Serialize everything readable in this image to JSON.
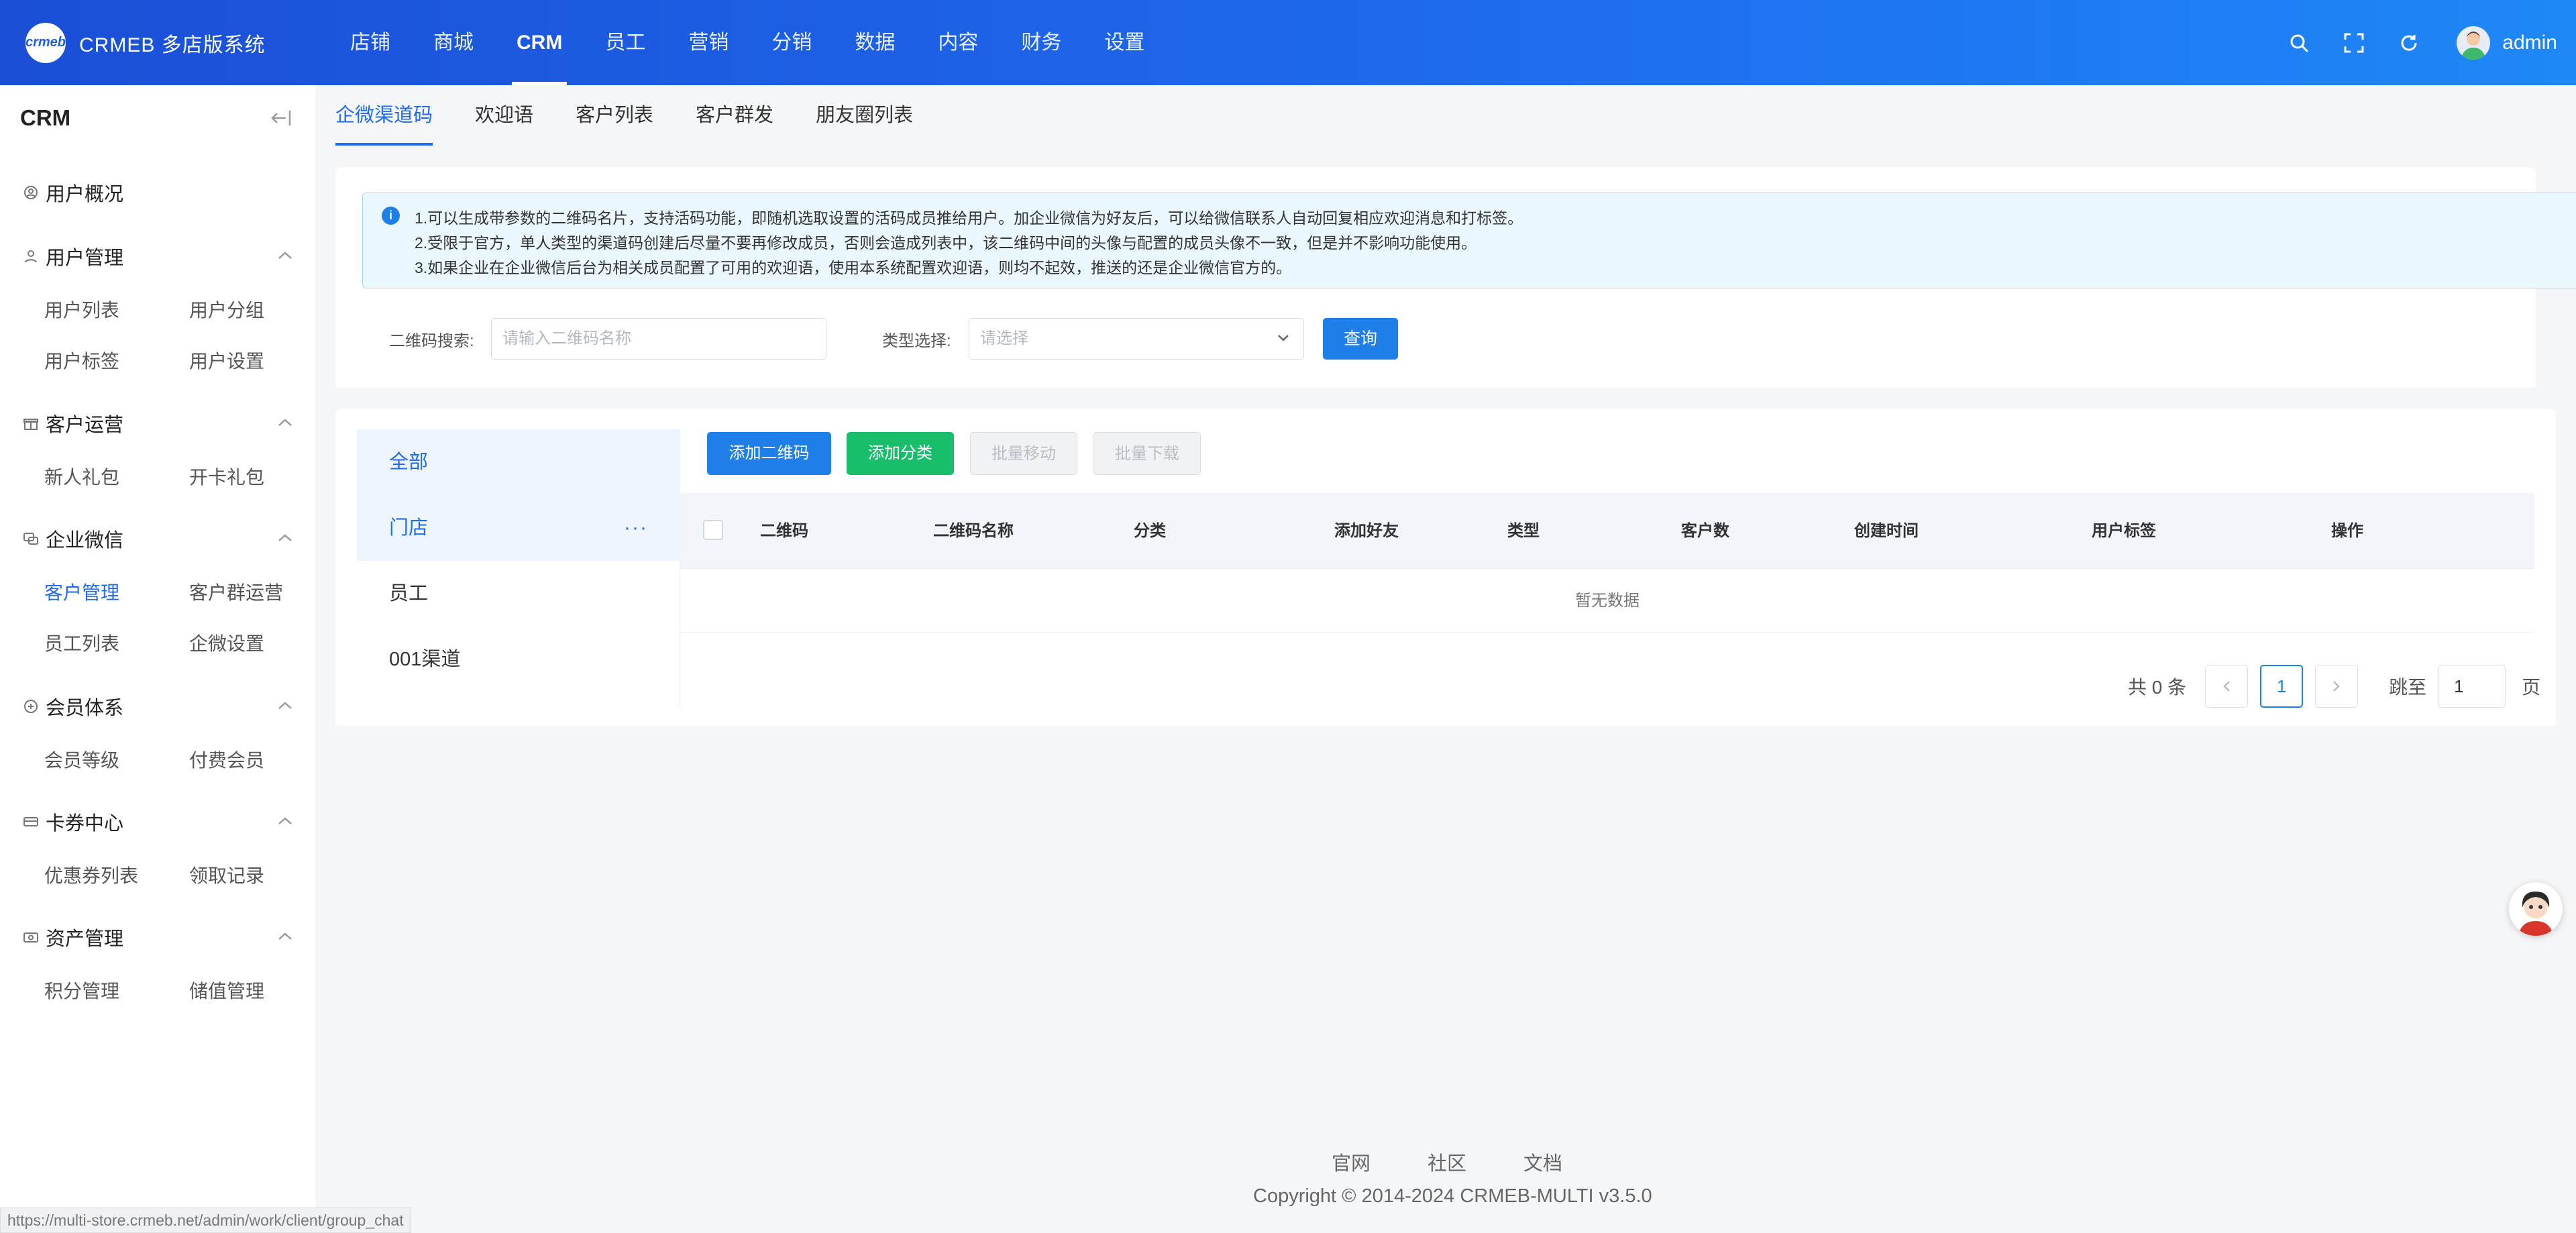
{
  "header": {
    "logo_badge": "crmeb",
    "brand": "CRMEB 多店版系统",
    "nav": [
      {
        "label": "店铺"
      },
      {
        "label": "商城"
      },
      {
        "label": "CRM"
      },
      {
        "label": "员工"
      },
      {
        "label": "营销"
      },
      {
        "label": "分销"
      },
      {
        "label": "数据"
      },
      {
        "label": "内容"
      },
      {
        "label": "财务"
      },
      {
        "label": "设置"
      }
    ],
    "active_nav": "CRM",
    "user": "admin"
  },
  "sidebar": {
    "title": "CRM",
    "groups": [
      {
        "label": "用户概况",
        "items": []
      },
      {
        "label": "用户管理",
        "items": [
          "用户列表",
          "用户分组",
          "用户标签",
          "用户设置"
        ]
      },
      {
        "label": "客户运营",
        "items": [
          "新人礼包",
          "开卡礼包"
        ]
      },
      {
        "label": "企业微信",
        "items": [
          "客户管理",
          "客户群运营",
          "员工列表",
          "企微设置"
        ]
      },
      {
        "label": "会员体系",
        "items": [
          "会员等级",
          "付费会员"
        ]
      },
      {
        "label": "卡券中心",
        "items": [
          "优惠券列表",
          "领取记录"
        ]
      },
      {
        "label": "资产管理",
        "items": [
          "积分管理",
          "储值管理"
        ]
      }
    ],
    "active_item": "客户管理"
  },
  "tabs": [
    "企微渠道码",
    "欢迎语",
    "客户列表",
    "客户群发",
    "朋友圈列表"
  ],
  "alert": {
    "lines": [
      "1.可以生成带参数的二维码名片，支持活码功能，即随机选取设置的活码成员推给用户。加企业微信为好友后，可以给微信联系人自动回复相应欢迎消息和打标签。",
      "2.受限于官方，单人类型的渠道码创建后尽量不要再修改成员，否则会造成列表中，该二维码中间的头像与配置的成员头像不一致，但是并不影响功能使用。",
      "3.如果企业在企业微信后台为相关成员配置了可用的欢迎语，使用本系统配置欢迎语，则均不起效，推送的还是企业微信官方的。"
    ]
  },
  "filter": {
    "qr_label": "二维码搜索:",
    "qr_placeholder": "请输入二维码名称",
    "type_label": "类型选择:",
    "type_placeholder": "请选择",
    "query_button": "查询"
  },
  "categories": [
    {
      "label": "全部"
    },
    {
      "label": "门店",
      "more": "···"
    },
    {
      "label": "员工"
    },
    {
      "label": "001渠道"
    }
  ],
  "toolbar": {
    "add_qr": "添加二维码",
    "add_category": "添加分类",
    "batch_move": "批量移动",
    "batch_download": "批量下载"
  },
  "table": {
    "columns": [
      "二维码",
      "二维码名称",
      "分类",
      "添加好友",
      "类型",
      "客户数",
      "创建时间",
      "用户标签",
      "操作"
    ],
    "empty_text": "暂无数据"
  },
  "pagination": {
    "total": "共 0 条",
    "current": "1",
    "jump_label": "跳至",
    "jump_value": "1",
    "unit": "页"
  },
  "footer": {
    "links": [
      "官网",
      "社区",
      "文档"
    ],
    "copyright": "Copyright © 2014-2024 CRMEB-MULTI v3.5.0"
  },
  "status_url": "https://multi-store.crmeb.net/admin/work/client/group_chat",
  "colors": {
    "primary": "#1f7fe8",
    "success": "#19be6b",
    "header_start": "#1a4fd6",
    "header_end": "#1e88f6"
  }
}
